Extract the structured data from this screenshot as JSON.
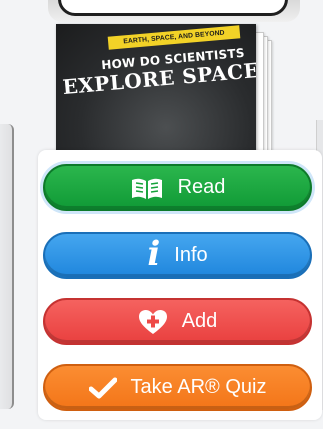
{
  "book": {
    "series_banner": "EARTH, SPACE, AND BEYOND",
    "title_line1": "HOW DO SCIENTISTS",
    "title_line2": "EXPLORE SPACE?"
  },
  "actions": {
    "read": {
      "label": "Read",
      "icon": "open-book-icon",
      "color": "#16a23b"
    },
    "info": {
      "label": "Info",
      "icon": "info-icon",
      "color": "#2c90e6"
    },
    "add": {
      "label": "Add",
      "icon": "heart-plus-icon",
      "color": "#ee4a48"
    },
    "quiz": {
      "label": "Take AR® Quiz",
      "icon": "checkmark-icon",
      "color": "#f7801f"
    }
  }
}
